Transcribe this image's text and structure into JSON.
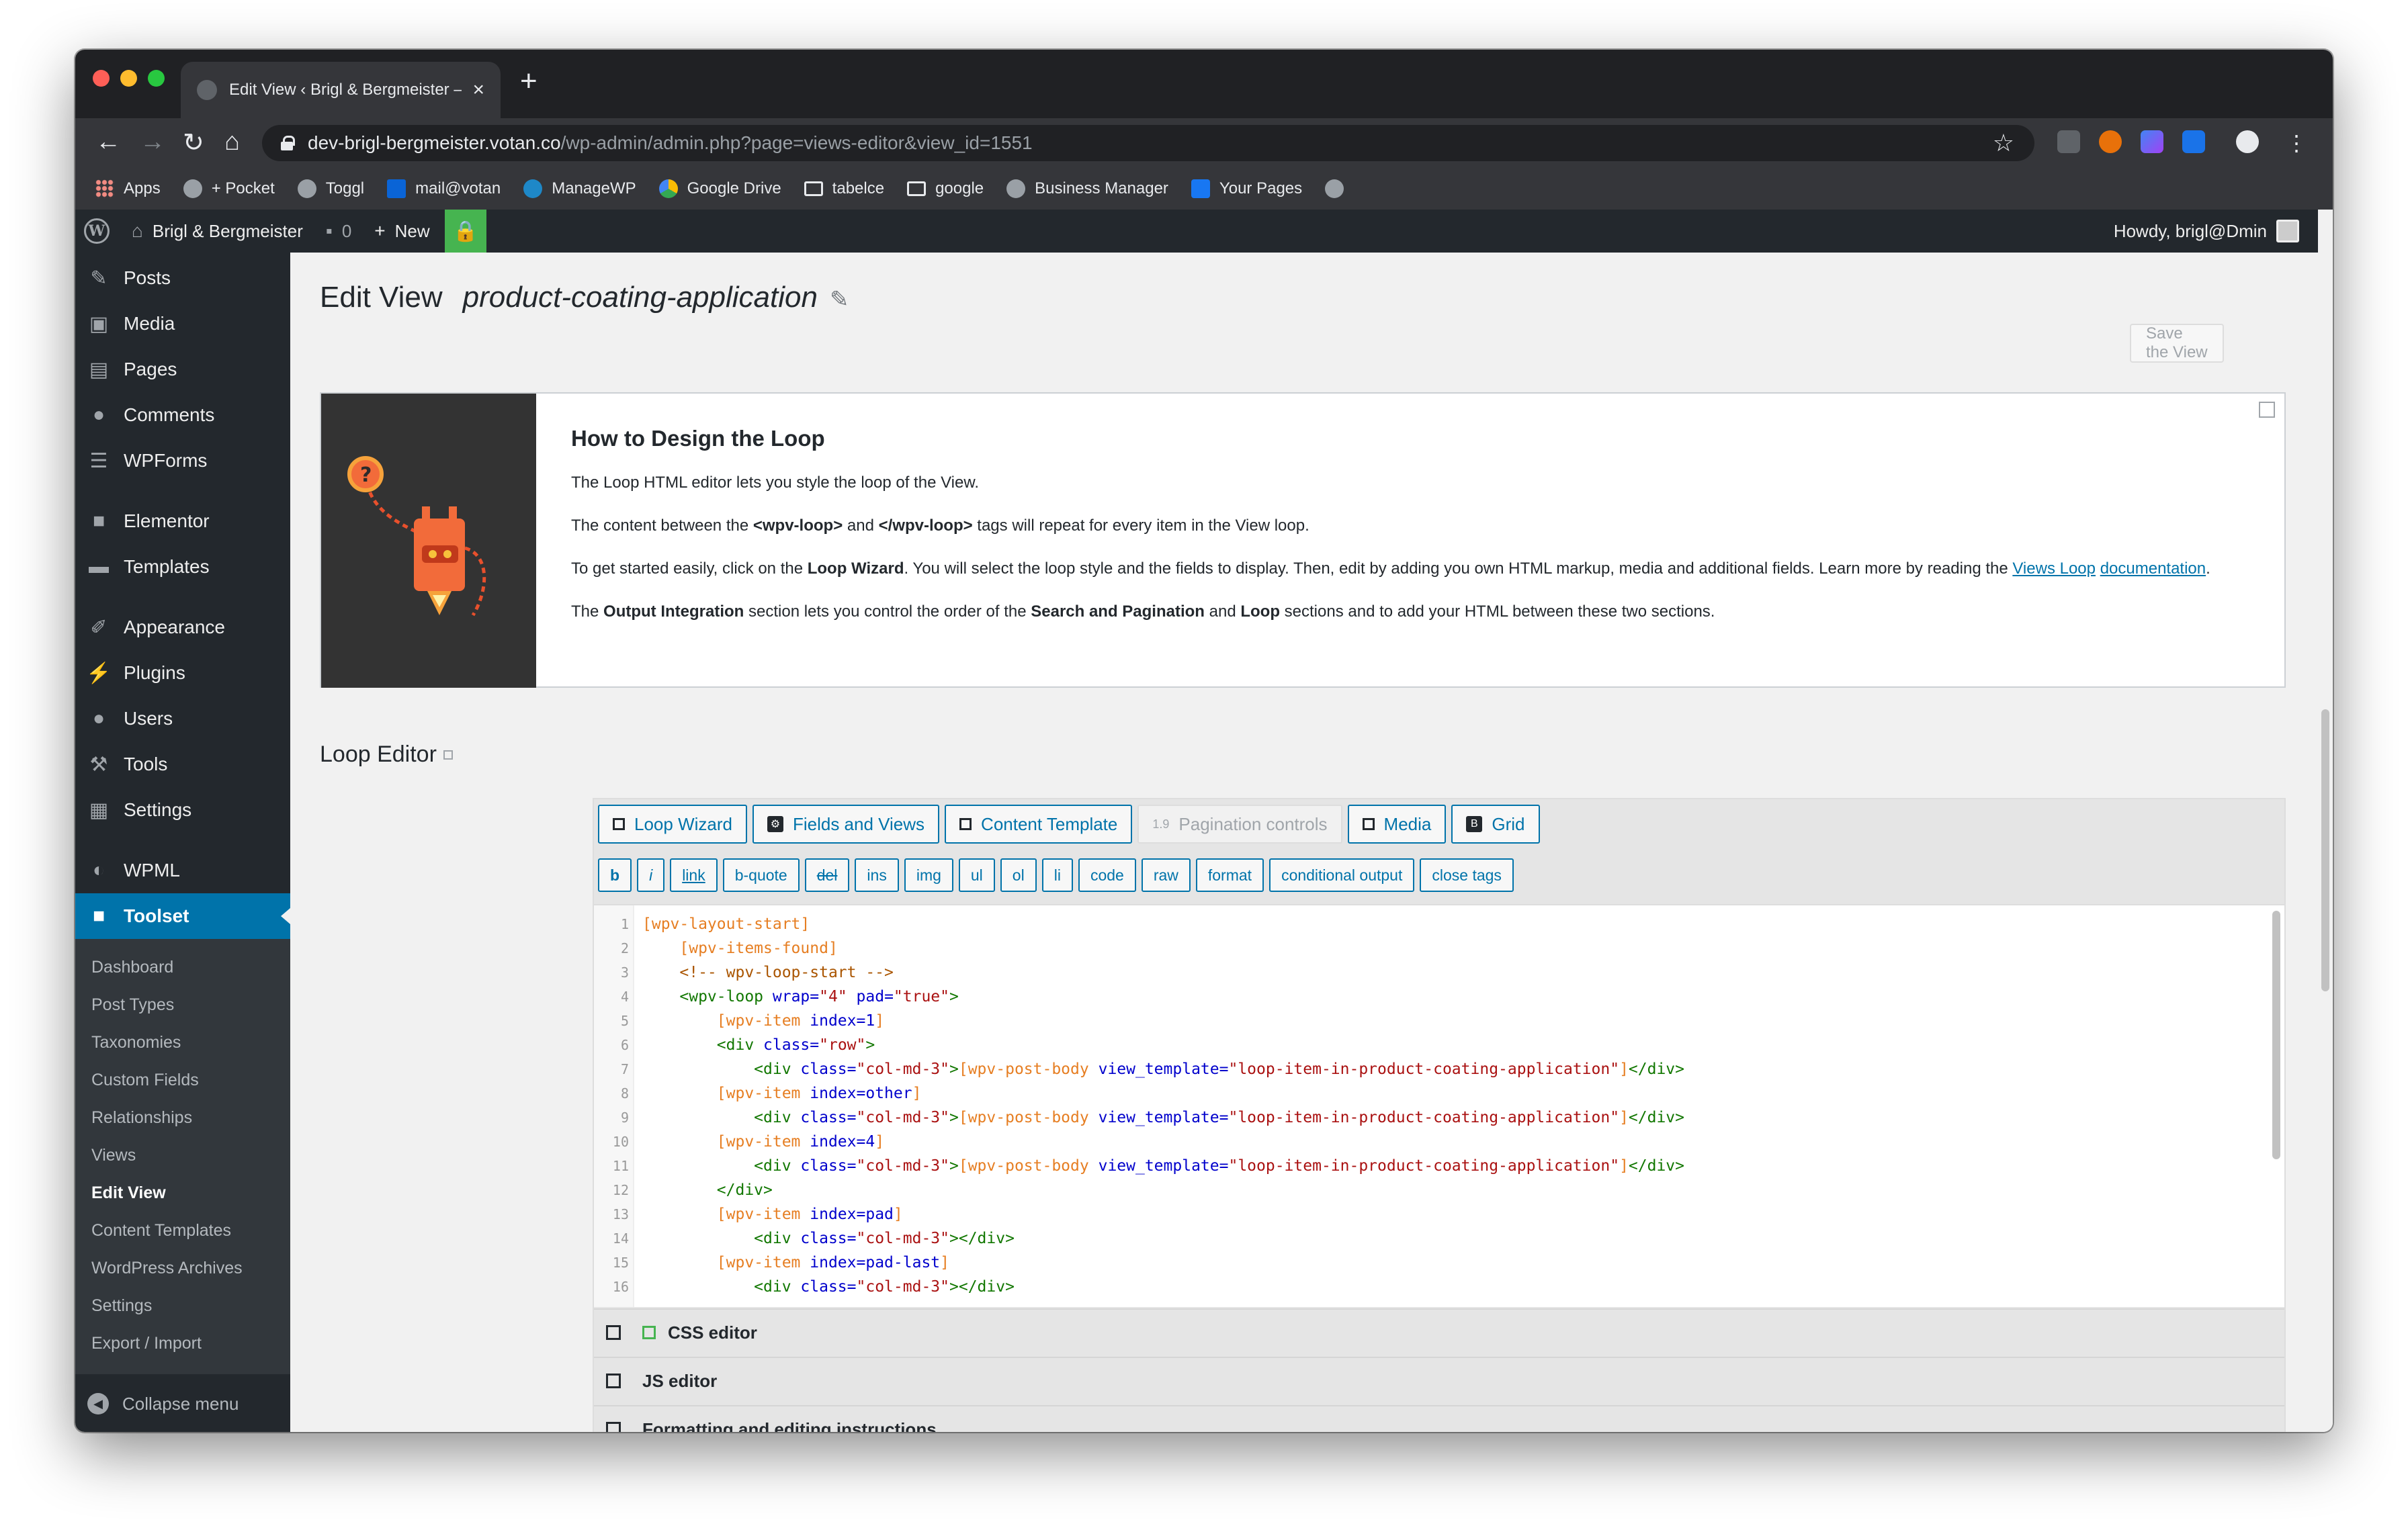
{
  "browser": {
    "tab_title": "Edit View ‹ Brigl & Bergmeister –",
    "url_host": "dev-brigl-bergmeister.votan.co",
    "url_path": "/wp-admin/admin.php?page=views-editor&view_id=1551",
    "bookmarks": [
      "Apps",
      "+ Pocket",
      "Toggl",
      "mail@votan",
      "ManageWP",
      "Google Drive",
      "tabelce",
      "google",
      "Business Manager",
      "Your Pages"
    ]
  },
  "adminbar": {
    "site_name": "Brigl & Bergmeister",
    "comments_count": "0",
    "new_label": "New",
    "howdy": "Howdy, brigl@Dmin"
  },
  "sidebar": {
    "menu": [
      {
        "label": "Posts",
        "icon": "pushpin-icon"
      },
      {
        "label": "Media",
        "icon": "media-icon"
      },
      {
        "label": "Pages",
        "icon": "pages-icon"
      },
      {
        "label": "Comments",
        "icon": "comment-icon"
      },
      {
        "label": "WPForms",
        "icon": "forms-icon"
      },
      {
        "label": "Elementor",
        "icon": "elementor-icon"
      },
      {
        "label": "Templates",
        "icon": "folder-icon"
      },
      {
        "label": "Appearance",
        "icon": "brush-icon"
      },
      {
        "label": "Plugins",
        "icon": "plug-icon"
      },
      {
        "label": "Users",
        "icon": "users-icon"
      },
      {
        "label": "Tools",
        "icon": "wrench-icon"
      },
      {
        "label": "Settings",
        "icon": "settings-icon"
      },
      {
        "label": "WPML",
        "icon": "wpml-icon"
      },
      {
        "label": "Toolset",
        "icon": "toolset-icon"
      }
    ],
    "submenu": [
      "Dashboard",
      "Post Types",
      "Taxonomies",
      "Custom Fields",
      "Relationships",
      "Views",
      "Edit View",
      "Content Templates",
      "WordPress Archives",
      "Settings",
      "Export / Import"
    ],
    "collapse_label": "Collapse menu"
  },
  "page": {
    "title": "Edit View",
    "view_name": "product-coating-application",
    "save_button": "Save the View"
  },
  "help": {
    "heading": "How to Design the Loop",
    "p1": "The Loop HTML editor lets you style the loop of the View.",
    "p2_a": "The content between the ",
    "p2_b": "<wpv-loop>",
    "p2_c": " and ",
    "p2_d": "</wpv-loop>",
    "p2_e": " tags will repeat for every item in the View loop.",
    "p3_a": "To get started easily, click on the ",
    "p3_b": "Loop Wizard",
    "p3_c": ". You will select the loop style and the fields to display. Then, edit by adding you own HTML markup, media and additional fields. Learn more by reading the ",
    "p3_link1": "Views Loop",
    "p3_link2": "documentation",
    "p3_d": ".",
    "p4_a": "The ",
    "p4_b": "Output Integration",
    "p4_c": " section lets you control the order of the ",
    "p4_d": "Search and Pagination",
    "p4_e": " and ",
    "p4_f": "Loop",
    "p4_g": " sections and to add your HTML between these two sections."
  },
  "loop_editor": {
    "title": "Loop Editor",
    "toolbar": [
      "Loop Wizard",
      "Fields and Views",
      "Content Template",
      "Pagination controls",
      "Media",
      "Grid"
    ],
    "quicktags": [
      "b",
      "i",
      "link",
      "b-quote",
      "del",
      "ins",
      "img",
      "ul",
      "ol",
      "li",
      "code",
      "raw",
      "format",
      "conditional output",
      "close tags"
    ],
    "code_lines": [
      "[wpv-layout-start]",
      "    [wpv-items-found]",
      "    <!-- wpv-loop-start -->",
      "    <wpv-loop wrap=\"4\" pad=\"true\">",
      "        [wpv-item index=1]",
      "        <div class=\"row\">",
      "            <div class=\"col-md-3\">[wpv-post-body view_template=\"loop-item-in-product-coating-application\"]</div>",
      "        [wpv-item index=other]",
      "            <div class=\"col-md-3\">[wpv-post-body view_template=\"loop-item-in-product-coating-application\"]</div>",
      "        [wpv-item index=4]",
      "            <div class=\"col-md-3\">[wpv-post-body view_template=\"loop-item-in-product-coating-application\"]</div>",
      "        </div>",
      "        [wpv-item index=pad]",
      "            <div class=\"col-md-3\"></div>",
      "        [wpv-item index=pad-last]",
      "            <div class=\"col-md-3\"></div>"
    ],
    "sections": [
      "CSS editor",
      "JS editor",
      "Formatting and editing instructions"
    ]
  }
}
